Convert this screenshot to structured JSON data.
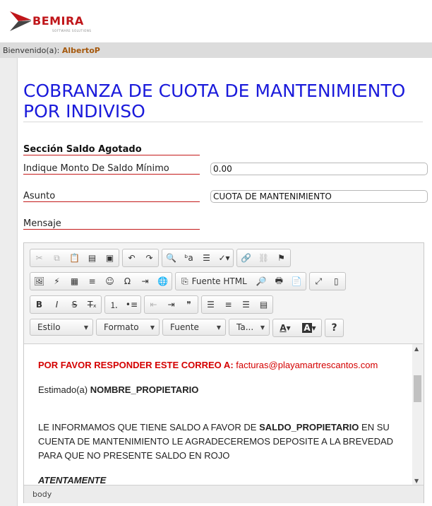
{
  "brand": {
    "name": "BEMIRA",
    "tagline": "SOFTWARE SOLUTIONS"
  },
  "welcome": {
    "label": "Bienvenido(a):",
    "user": "AlbertoP"
  },
  "page": {
    "title": "COBRANZA DE CUOTA DE MANTENIMIENTO POR INDIVISO"
  },
  "form": {
    "section": "Sección Saldo Agotado",
    "monto_label": "Indique Monto De Saldo Mínimo",
    "monto_value": "0.00",
    "asunto_label": "Asunto",
    "asunto_value": "CUOTA DE MANTENIMIENTO",
    "mensaje_label": "Mensaje"
  },
  "editor": {
    "toolbar": {
      "source_label": "Fuente HTML",
      "style_label": "Estilo",
      "format_label": "Formato",
      "font_label": "Fuente",
      "size_label": "Ta...",
      "help_label": "?"
    },
    "content": {
      "line1_label": "POR FAVOR RESPONDER ESTE CORREO A:",
      "line1_email": "facturas@playamartrescantos.com",
      "greeting_prefix": "Estimado(a)",
      "greeting_name": "NOMBRE_PROPIETARIO",
      "body_part1": "LE INFORMAMOS QUE TIENE SALDO A FAVOR DE",
      "body_var": "SALDO_PROPIETARIO",
      "body_part2": "EN SU CUENTA DE MANTENIMIENTO LE AGRADECEREMOS DEPOSITE A LA BREVEDAD PARA QUE NO PRESENTE SALDO EN ROJO",
      "closing": "ATENTAMENTE"
    },
    "status_path": "body"
  },
  "colors": {
    "accent_red": "#c41a1a",
    "title_blue": "#1a1adb",
    "user_orange": "#a5580c"
  }
}
